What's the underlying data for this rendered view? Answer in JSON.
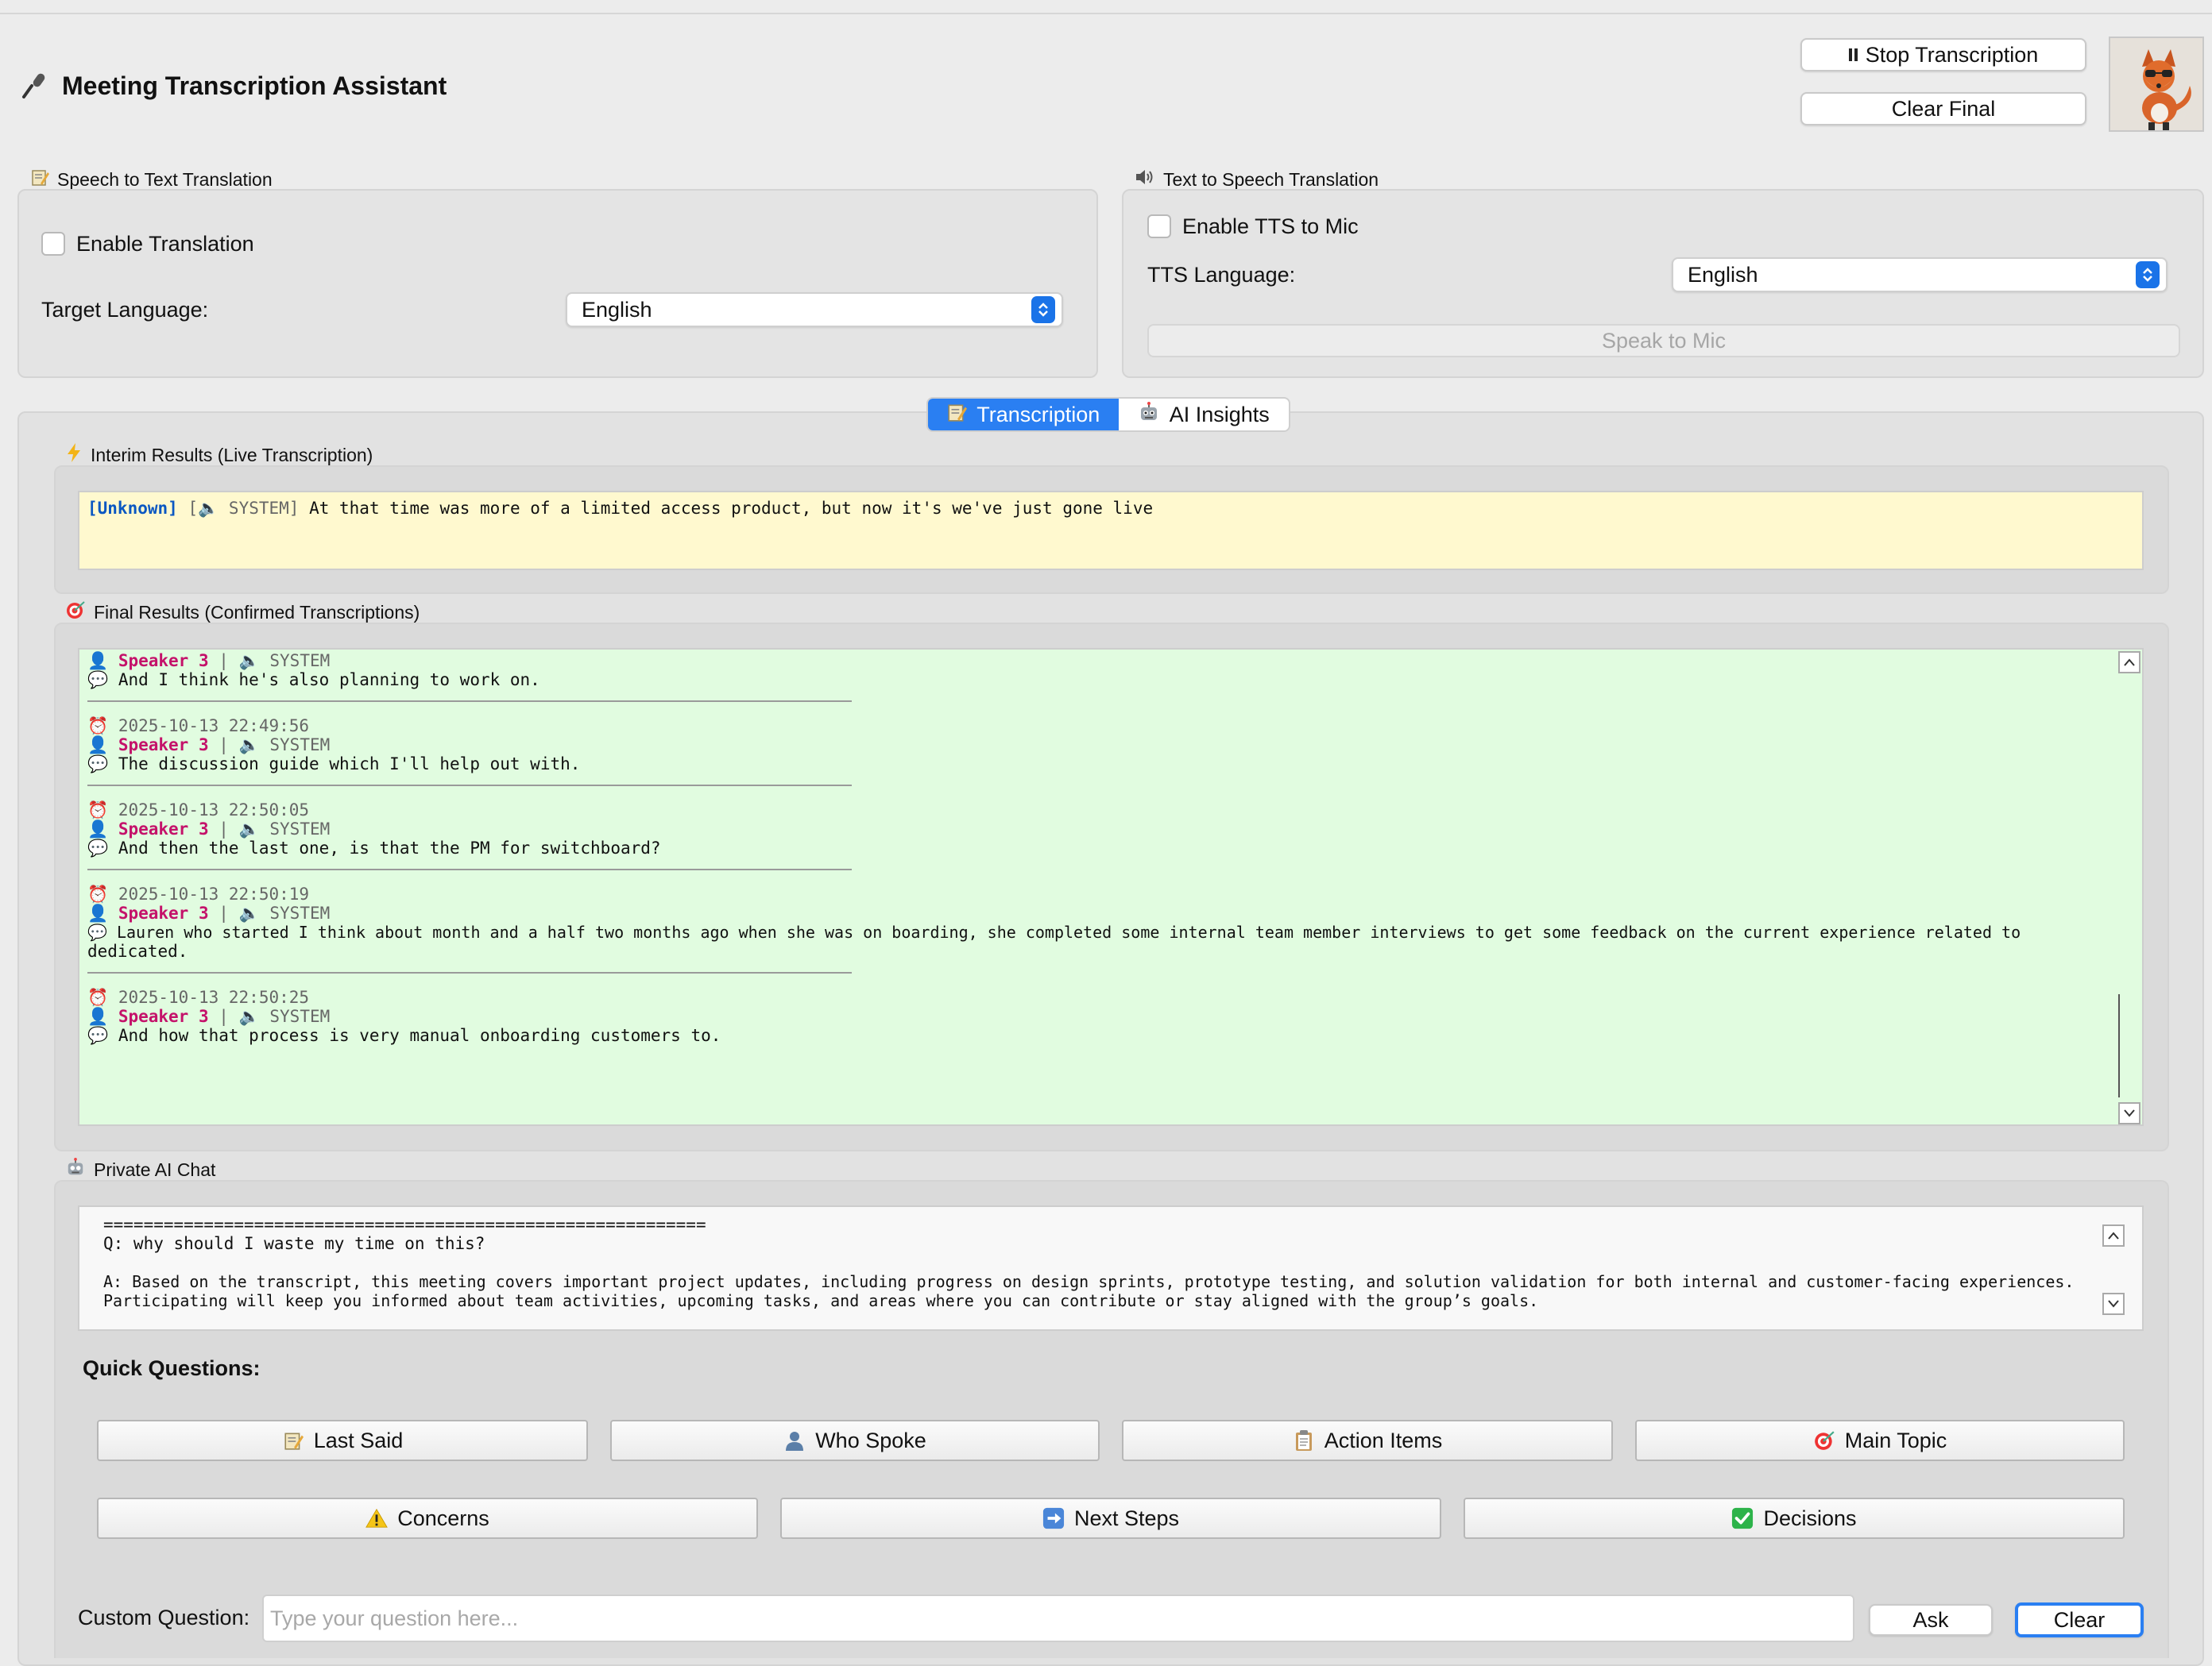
{
  "app": {
    "title": "Meeting Transcription Assistant",
    "stop_button": "Stop Transcription",
    "clear_final_button": "Clear Final"
  },
  "speech_to_text": {
    "group_title": "Speech to Text Translation",
    "enable_label": "Enable Translation",
    "target_language_label": "Target Language:",
    "target_language_value": "English"
  },
  "text_to_speech": {
    "group_title": "Text to Speech Translation",
    "enable_label": "Enable TTS to Mic",
    "tts_language_label": "TTS Language:",
    "tts_language_value": "English",
    "speak_button": "Speak to Mic"
  },
  "tabs": [
    {
      "label": "Transcription",
      "icon": "memo-icon",
      "active": true
    },
    {
      "label": "AI Insights",
      "icon": "robot-icon",
      "active": false
    }
  ],
  "interim": {
    "group_title": "Interim Results (Live Transcription)",
    "speaker_tag": "[Unknown]",
    "source_open": "[",
    "source": "SYSTEM]",
    "text": "At that time was more of a limited access product, but now it's we've just gone live"
  },
  "final": {
    "group_title": "Final Results (Confirmed Transcriptions)",
    "entries": [
      {
        "timestamp": "",
        "speaker": "Speaker 3",
        "source": "SYSTEM",
        "text": "And I think he's also planning to work on."
      },
      {
        "timestamp": "2025-10-13 22:49:56",
        "speaker": "Speaker 3",
        "source": "SYSTEM",
        "text": "The discussion guide which I'll help out with."
      },
      {
        "timestamp": "2025-10-13 22:50:05",
        "speaker": "Speaker 3",
        "source": "SYSTEM",
        "text": "And then the last one, is that the PM for switchboard?"
      },
      {
        "timestamp": "2025-10-13 22:50:19",
        "speaker": "Speaker 3",
        "source": "SYSTEM",
        "text": "Lauren who started I think about month and a half two months ago when she was on boarding, she completed some internal team member interviews to get some feedback on the current experience related to",
        "text_cont": "dedicated."
      },
      {
        "timestamp": "2025-10-13 22:50:25",
        "speaker": "Speaker 3",
        "source": "SYSTEM",
        "text": "And how that process is very manual onboarding customers to."
      }
    ]
  },
  "chat": {
    "group_title": "Private AI Chat",
    "separator": "============================================================",
    "question": "Q: why should I waste my time on this?",
    "answer_line1": "A: Based on the transcript, this meeting covers important project updates, including progress on design sprints, prototype testing, and solution validation for both internal and customer-facing experiences.",
    "answer_line2": "Participating will keep you informed about team activities, upcoming tasks, and areas where you can contribute or stay aligned with the group’s goals."
  },
  "quick_questions": {
    "title": "Quick Questions:",
    "row1": [
      {
        "label": "Last Said",
        "icon": "memo-icon"
      },
      {
        "label": "Who Spoke",
        "icon": "person-icon"
      },
      {
        "label": "Action Items",
        "icon": "clipboard-icon"
      },
      {
        "label": "Main Topic",
        "icon": "target-icon"
      }
    ],
    "row2": [
      {
        "label": "Concerns",
        "icon": "warning-icon"
      },
      {
        "label": "Next Steps",
        "icon": "arrow-right-icon"
      },
      {
        "label": "Decisions",
        "icon": "check-icon"
      }
    ]
  },
  "custom_question": {
    "label": "Custom Question:",
    "placeholder": "Type your question here...",
    "ask_button": "Ask",
    "clear_button": "Clear"
  }
}
